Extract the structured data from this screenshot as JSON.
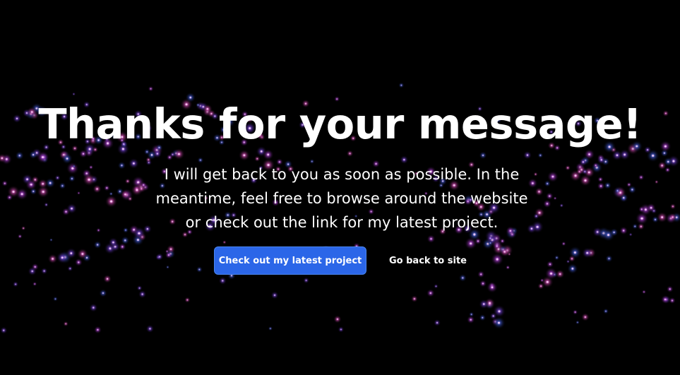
{
  "page": {
    "background": "#000000",
    "particle_colors": [
      "#d24bff",
      "#4f6bff",
      "#ff5ad8",
      "#8a4dff"
    ]
  },
  "hero": {
    "headline": "Thanks for your message!",
    "subtext_lines": [
      "I will get back to you as soon as possible. In the",
      "meantime, feel free to browse around the website",
      "or check out the link for my latest project."
    ]
  },
  "actions": {
    "primary_label": "Check out my latest project",
    "primary_color": "#2b66e8",
    "secondary_label": "Go back to site"
  }
}
